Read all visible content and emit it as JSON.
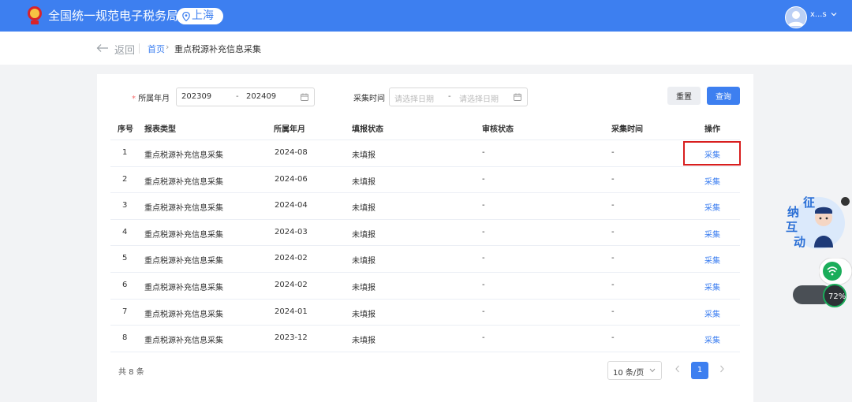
{
  "header": {
    "app_title": "全国统一规范电子税务局",
    "region": "上海",
    "username": "x...s"
  },
  "breadcrumb": {
    "back_label": "返回",
    "home": "首页",
    "separator": "›",
    "current": "重点税源补充信息采集"
  },
  "filters": {
    "period_label": "所属年月",
    "required_mark": "*",
    "period_start": "202309",
    "range_separator": "-",
    "period_end": "202409",
    "collect_time_label": "采集时间",
    "collect_start_placeholder": "请选择日期",
    "collect_end_placeholder": "请选择日期",
    "reset_label": "重置",
    "query_label": "查询"
  },
  "table": {
    "columns": [
      "序号",
      "报表类型",
      "所属年月",
      "填报状态",
      "审核状态",
      "采集时间",
      "操作"
    ],
    "rows": [
      {
        "no": "1",
        "type": "重点税源补充信息采集",
        "period": "2024-08",
        "fill_status": "未填报",
        "audit_status": "-",
        "collect_time": "-",
        "action": "采集"
      },
      {
        "no": "2",
        "type": "重点税源补充信息采集",
        "period": "2024-06",
        "fill_status": "未填报",
        "audit_status": "-",
        "collect_time": "-",
        "action": "采集"
      },
      {
        "no": "3",
        "type": "重点税源补充信息采集",
        "period": "2024-04",
        "fill_status": "未填报",
        "audit_status": "-",
        "collect_time": "-",
        "action": "采集"
      },
      {
        "no": "4",
        "type": "重点税源补充信息采集",
        "period": "2024-03",
        "fill_status": "未填报",
        "audit_status": "-",
        "collect_time": "-",
        "action": "采集"
      },
      {
        "no": "5",
        "type": "重点税源补充信息采集",
        "period": "2024-02",
        "fill_status": "未填报",
        "audit_status": "-",
        "collect_time": "-",
        "action": "采集"
      },
      {
        "no": "6",
        "type": "重点税源补充信息采集",
        "period": "2024-02",
        "fill_status": "未填报",
        "audit_status": "-",
        "collect_time": "-",
        "action": "采集"
      },
      {
        "no": "7",
        "type": "重点税源补充信息采集",
        "period": "2024-01",
        "fill_status": "未填报",
        "audit_status": "-",
        "collect_time": "-",
        "action": "采集"
      },
      {
        "no": "8",
        "type": "重点税源补充信息采集",
        "period": "2023-12",
        "fill_status": "未填报",
        "audit_status": "-",
        "collect_time": "-",
        "action": "采集"
      }
    ]
  },
  "pagination": {
    "total": "共 8 条",
    "page_size": "10 条/页",
    "current_page": "1"
  },
  "floating_widget": {
    "chars": [
      "征",
      "纳",
      "互",
      "动"
    ],
    "speed_percent": "72%"
  },
  "colors": {
    "primary": "#3d7ff0",
    "highlight": "#d81e1e",
    "required": "#f56c6c"
  }
}
